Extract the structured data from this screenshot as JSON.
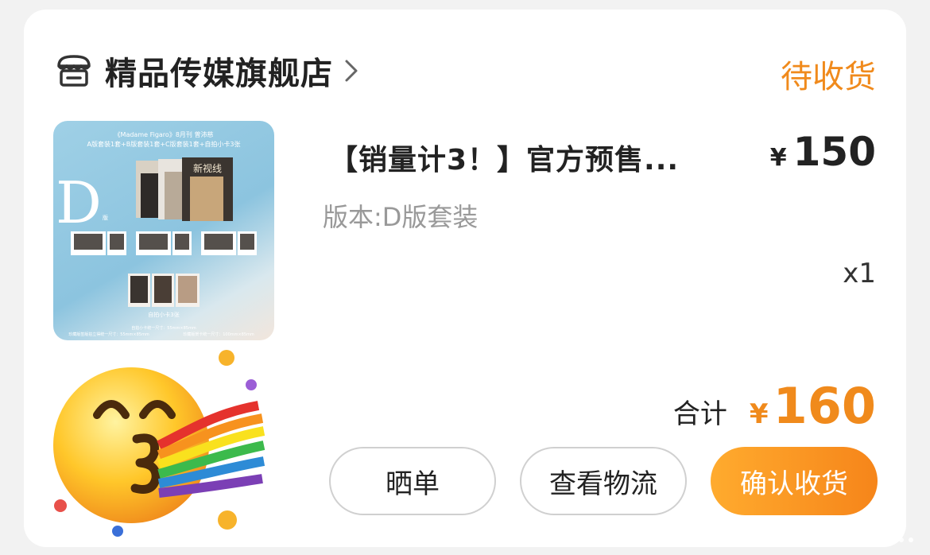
{
  "shop": {
    "name": "精品传媒旗舰店",
    "icon": "store-icon"
  },
  "order": {
    "status": "待收货",
    "product_title": "【销量计3！】官方预售...",
    "variant": "版本:D版套装",
    "price_currency": "¥",
    "price": "150",
    "quantity": "x1",
    "total_label": "合计",
    "total_currency": "¥",
    "total": "160"
  },
  "thumbnail": {
    "header_line1": "《Madame Figaro》8月刊 曾沛慈",
    "header_line2": "A版套装1套+B版套装1套+C版套装1套+自拍小卡3张",
    "big_letter": "D",
    "small_label": "版",
    "mag_label": "新视线",
    "mini_label": "自拍小卡3张",
    "footer_line1": "自拍小卡统一尺寸：55mm×85mm",
    "footer_line2": "珍藏版签版拍立得统一尺寸：55mm×85mm",
    "footer_line3": "珍藏版贺卡统一尺寸：100mm×85mm"
  },
  "buttons": {
    "show_order": "晒单",
    "view_logistics": "查看物流",
    "confirm_receipt": "确认收货"
  },
  "colors": {
    "accent": "#f08a1c",
    "button_gradient_start": "#ffab2e",
    "button_gradient_end": "#f6851a",
    "thumbnail_bg": "#8cc4df"
  }
}
